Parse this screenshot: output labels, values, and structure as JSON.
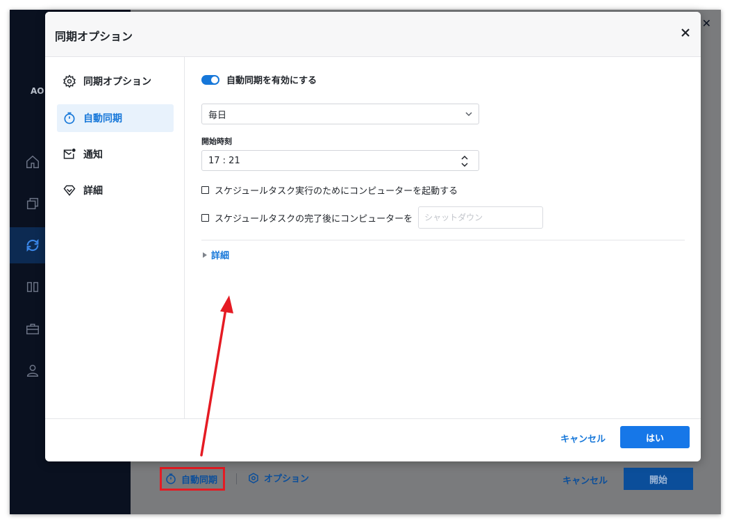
{
  "app": {
    "logo_text": "AO",
    "footer": {
      "auto_sync_label": "自動同期",
      "options_label": "オプション",
      "cancel_label": "キャンセル",
      "start_label": "開始"
    },
    "close_glyph": "✕"
  },
  "dialog": {
    "title": "同期オプション",
    "menu": [
      {
        "label": "同期オプション",
        "icon": "gear-icon"
      },
      {
        "label": "自動同期",
        "icon": "stopwatch-icon",
        "active": true
      },
      {
        "label": "通知",
        "icon": "mail-notification-icon"
      },
      {
        "label": "詳細",
        "icon": "diamond-icon"
      }
    ],
    "auto_sync": {
      "toggle_label": "自動同期を有効にする",
      "enabled": true,
      "frequency": "毎日",
      "start_time_label": "開始時刻",
      "start_time": "17 : 21",
      "wake_computer_label": "スケジュールタスク実行のためにコンピューターを起動する",
      "after_task_label": "スケジュールタスクの完了後にコンピューターを",
      "after_task_placeholder": "シャットダウン",
      "details_label": "詳細"
    },
    "footer": {
      "cancel_label": "キャンセル",
      "ok_label": "はい"
    }
  },
  "colors": {
    "accent": "#1677d9",
    "annotation": "#e51b23",
    "sidebar_bg": "#0a1120"
  }
}
